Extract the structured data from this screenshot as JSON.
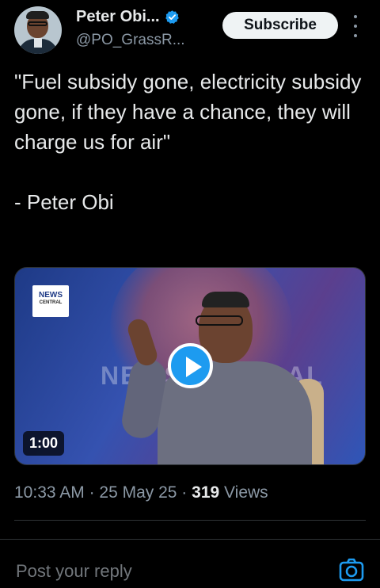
{
  "tweet": {
    "author": {
      "display_name": "Peter Obi...",
      "handle": "@PO_GrassR...",
      "verified": true,
      "verified_color": "#1d9bf0"
    },
    "subscribe_label": "Subscribe",
    "text": "\"Fuel subsidy gone, electricity subsidy gone, if they have a chance, they will charge us for air\"\n\n- Peter Obi",
    "media": {
      "type": "video",
      "duration": "1:00",
      "logo_line1": "NEWS",
      "logo_line2": "CENTRAL",
      "watermark": "NEWS CENTRAL"
    },
    "time": "10:33 AM",
    "separator": " · ",
    "date": "25 May 25",
    "views_count": "319",
    "views_label": "Views"
  },
  "reply": {
    "placeholder": "Post your reply"
  },
  "colors": {
    "background": "#000000",
    "accent": "#1d9bf0",
    "muted_text": "#8b98a5"
  },
  "icons": [
    "verified-badge-icon",
    "more-options-icon",
    "play-icon",
    "camera-icon"
  ]
}
